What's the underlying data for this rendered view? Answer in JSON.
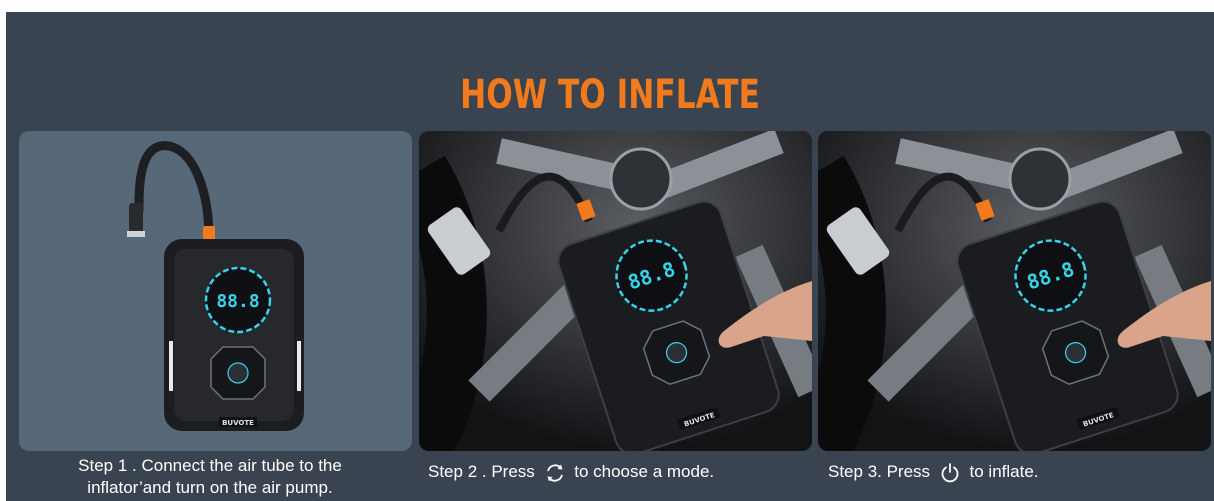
{
  "title": "HOW TO INFLATE",
  "brand": "BUVOTE",
  "display_reading": "88.8",
  "colors": {
    "background": "#3a4350",
    "title": "#f07a1c",
    "card1_bg": "#576879",
    "display_glow": "#37d3e8"
  },
  "steps": [
    {
      "line1": "Step 1 .  Connect the air tube to the",
      "line2": "inflator’and turn on the air pump."
    },
    {
      "before": "Step 2 . Press",
      "icon": "cycle-icon",
      "after": "to  choose a mode."
    },
    {
      "before": "Step 3. Press",
      "icon": "power-icon",
      "after": "to inflate."
    }
  ]
}
